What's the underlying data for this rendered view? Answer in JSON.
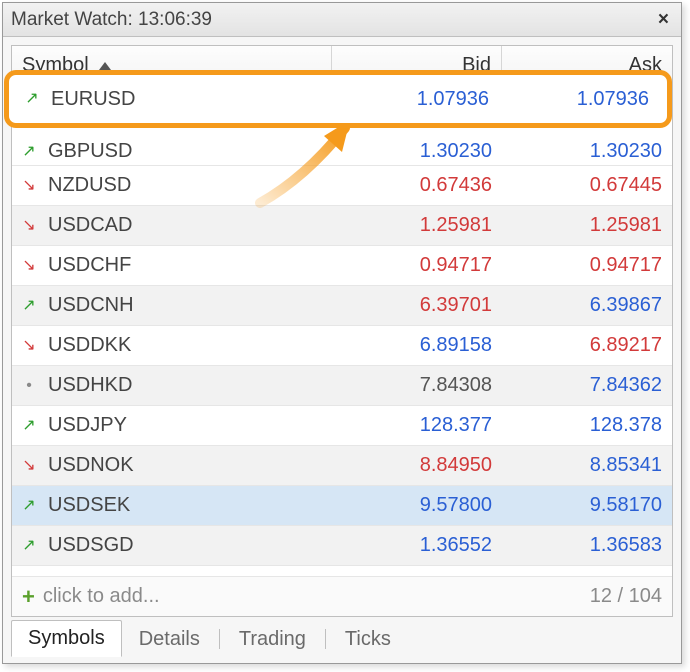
{
  "title": "Market Watch: 13:06:39",
  "columns": {
    "symbol": "Symbol",
    "bid": "Bid",
    "ask": "Ask"
  },
  "callout": {
    "dir": "up",
    "symbol": "EURUSD",
    "bid": "1.07936",
    "ask": "1.07936",
    "bid_color": "blue",
    "ask_color": "blue"
  },
  "rows": [
    {
      "dir": "up",
      "symbol": "GBPUSD",
      "bid": "1.30230",
      "ask": "1.30230",
      "bid_color": "blue",
      "ask_color": "blue",
      "shade": false,
      "cut": true
    },
    {
      "dir": "down",
      "symbol": "NZDUSD",
      "bid": "0.67436",
      "ask": "0.67445",
      "bid_color": "red",
      "ask_color": "red",
      "shade": false
    },
    {
      "dir": "down",
      "symbol": "USDCAD",
      "bid": "1.25981",
      "ask": "1.25981",
      "bid_color": "red",
      "ask_color": "red",
      "shade": true
    },
    {
      "dir": "down",
      "symbol": "USDCHF",
      "bid": "0.94717",
      "ask": "0.94717",
      "bid_color": "red",
      "ask_color": "red",
      "shade": false
    },
    {
      "dir": "up",
      "symbol": "USDCNH",
      "bid": "6.39701",
      "ask": "6.39867",
      "bid_color": "red",
      "ask_color": "blue",
      "shade": true
    },
    {
      "dir": "down",
      "symbol": "USDDKK",
      "bid": "6.89158",
      "ask": "6.89217",
      "bid_color": "blue",
      "ask_color": "red",
      "shade": false
    },
    {
      "dir": "flat",
      "symbol": "USDHKD",
      "bid": "7.84308",
      "ask": "7.84362",
      "bid_color": "gray",
      "ask_color": "blue",
      "shade": true
    },
    {
      "dir": "up",
      "symbol": "USDJPY",
      "bid": "128.377",
      "ask": "128.378",
      "bid_color": "blue",
      "ask_color": "blue",
      "shade": false
    },
    {
      "dir": "down",
      "symbol": "USDNOK",
      "bid": "8.84950",
      "ask": "8.85341",
      "bid_color": "red",
      "ask_color": "blue",
      "shade": true
    },
    {
      "dir": "up",
      "symbol": "USDSEK",
      "bid": "9.57800",
      "ask": "9.58170",
      "bid_color": "blue",
      "ask_color": "blue",
      "shade": false,
      "highlight": true
    },
    {
      "dir": "up",
      "symbol": "USDSGD",
      "bid": "1.36552",
      "ask": "1.36583",
      "bid_color": "blue",
      "ask_color": "blue",
      "shade": true
    }
  ],
  "footer": {
    "add_hint": "click to add...",
    "count": "12 / 104"
  },
  "tabs": [
    {
      "label": "Symbols",
      "active": true
    },
    {
      "label": "Details",
      "active": false
    },
    {
      "label": "Trading",
      "active": false
    },
    {
      "label": "Ticks",
      "active": false
    }
  ]
}
